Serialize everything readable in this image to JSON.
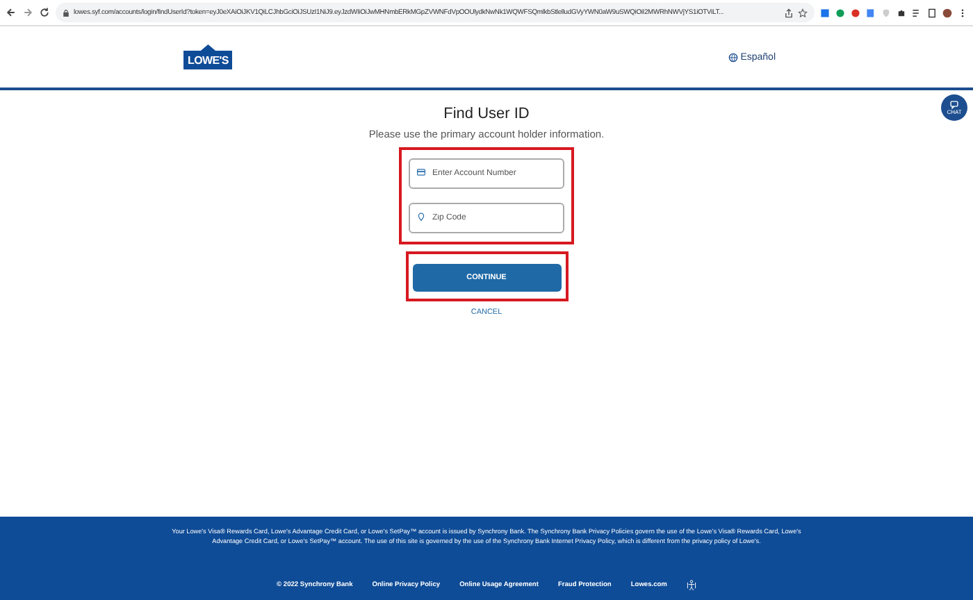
{
  "browser": {
    "url": "lowes.syf.com/accounts/login/findUserId?token=eyJ0eXAiOiJKV1QiLCJhbGciOiJSUzI1NiJ9.eyJzdWIiOiJwMHNmbERkMGpZVWNFdVpOOUlydkNwNk1WQWFSQmlkbStlelludGVyYWN0aW9uSWQiOiI2MWRhNWVjYS1iOTViLT..."
  },
  "header": {
    "logo": "LOWE'S",
    "language": "Español",
    "chat": "CHAT"
  },
  "form": {
    "title": "Find User ID",
    "subtitle": "Please use the primary account holder information.",
    "fields": [
      {
        "kind": "card",
        "placeholder": "Enter Account Number"
      },
      {
        "kind": "pin",
        "placeholder": "Zip Code"
      }
    ],
    "continue": "CONTINUE",
    "cancel": "CANCEL"
  },
  "footer": {
    "disclaimer": "Your Lowe's Visa® Rewards Card, Lowe's Advantage Credit Card, or Lowe's SetPay™ account is issued by Synchrony Bank. The Synchrony Bank Privacy Policies govern the use of the Lowe's Visa® Rewards Card, Lowe's Advantage Credit Card, or Lowe's SetPay™ account. The use of this site is governed by the use of the Synchrony Bank Internet Privacy Policy, which is different from the privacy policy of Lowe's.",
    "copyright": "© 2022 Synchrony Bank",
    "links": [
      "Online Privacy Policy",
      "Online Usage Agreement",
      "Fraud Protection",
      "Lowes.com"
    ]
  }
}
